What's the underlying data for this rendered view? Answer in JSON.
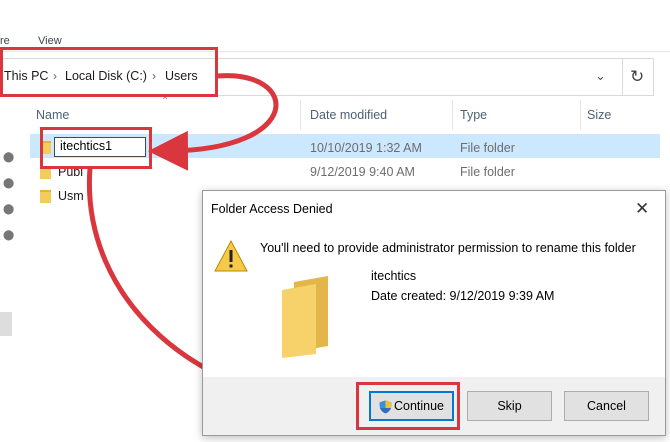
{
  "ribbon": {
    "tab_share": "re",
    "tab_view": "View"
  },
  "address_bar": {
    "crumbs": [
      "This PC",
      "Local Disk (C:)",
      "Users"
    ]
  },
  "columns": {
    "name": "Name",
    "date_modified": "Date modified",
    "type": "Type",
    "size": "Size"
  },
  "files": [
    {
      "name": "itechtics1",
      "date": "10/10/2019 1:32 AM",
      "type": "File folder",
      "renaming": true
    },
    {
      "name": "Publ",
      "date": "9/12/2019 9:40 AM",
      "type": "File folder"
    },
    {
      "name": "Usm",
      "date": "",
      "type": ""
    }
  ],
  "dialog": {
    "title": "Folder Access Denied",
    "message": "You'll need to provide administrator permission to rename this folder",
    "folder_name": "itechtics",
    "date_created": "Date created: 9/12/2019 9:39 AM",
    "buttons": {
      "continue": "Continue",
      "skip": "Skip",
      "cancel": "Cancel"
    }
  },
  "colors": {
    "annotation_red": "#d9363e",
    "selection": "#cce8ff",
    "primary_border": "#0078d7",
    "folder": "#f3cd5c"
  },
  "icons": [
    "pin-icon",
    "folder-icon",
    "warning-icon",
    "shield-icon",
    "refresh-icon",
    "close-icon",
    "chevron-down-icon"
  ]
}
